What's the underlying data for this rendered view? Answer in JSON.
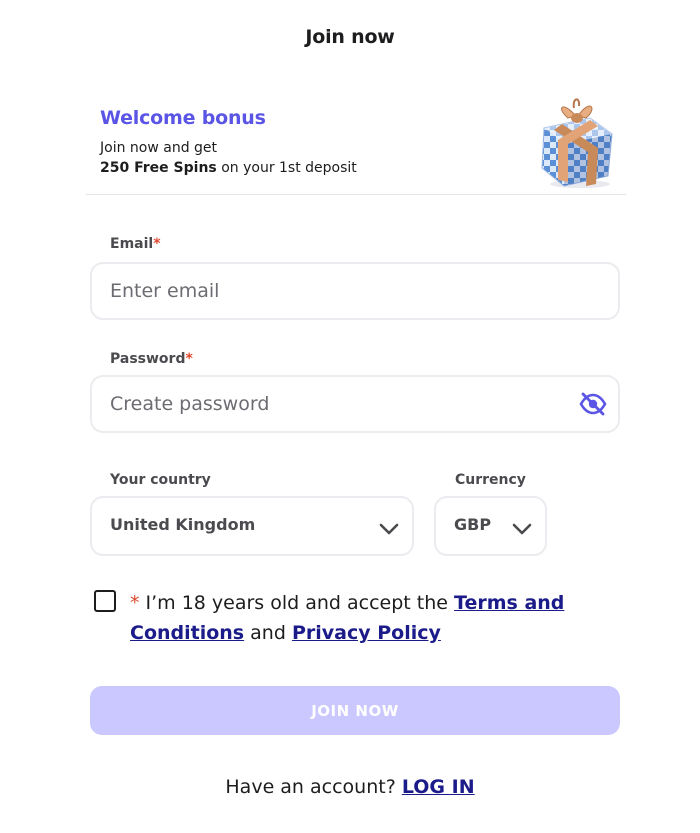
{
  "header": {
    "title": "Join now"
  },
  "bonus": {
    "heading": "Welcome bonus",
    "line1": "Join now and get",
    "line2_bold": "250 Free Spins",
    "line2_rest": " on your 1st deposit",
    "image": "gift-box-image"
  },
  "form": {
    "required_mark": "*",
    "email": {
      "label": "Email",
      "placeholder": "Enter email",
      "value": ""
    },
    "password": {
      "label": "Password",
      "placeholder": "Create password",
      "value": "",
      "toggle_icon": "eye-slash-icon"
    },
    "country": {
      "label": "Your country",
      "value": "United Kingdom",
      "icon": "chevron-down-icon"
    },
    "currency": {
      "label": "Currency",
      "value": "GBP",
      "icon": "chevron-down-icon"
    },
    "consent": {
      "checked": false,
      "text_before": "I’m 18 years old and accept the ",
      "terms_label": "Terms and Conditions",
      "text_between": " and ",
      "privacy_label": "Privacy Policy"
    },
    "submit_label": "JOIN NOW"
  },
  "footer": {
    "prompt": "Have an account? ",
    "login_label": "LOG IN"
  },
  "colors": {
    "accent": "#5b55e6",
    "button_disabled": "#cac8fe",
    "link": "#1b1b8a",
    "required": "#e0482d"
  }
}
